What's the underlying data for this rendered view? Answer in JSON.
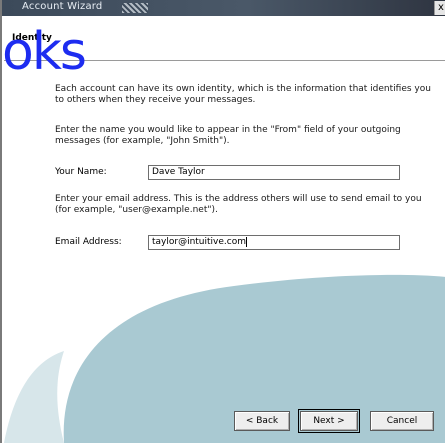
{
  "window": {
    "title": "Account Wizard",
    "close_glyph": "x"
  },
  "header": {
    "heading": "Identity"
  },
  "content": {
    "intro": "Each account can have its own identity, which is the information that identifies you to others when they receive your messages.",
    "name_instructions": "Enter the name you would like to appear in the \"From\" field of your outgoing messages (for example, \"John Smith\").",
    "name_label": "Your Name:",
    "name_value": "Dave Taylor",
    "email_instructions": "Enter your email address. This is the address others will use to send email to you (for example, \"user@example.net\").",
    "email_label": "Email Address:",
    "email_value": "taylor@intuitive.com"
  },
  "buttons": {
    "back": "< Back",
    "next": "Next >",
    "cancel": "Cancel"
  },
  "watermark": {
    "text": "oks"
  },
  "colors": {
    "watermark": "#1d2cf0",
    "swoosh": "#a9c9d2",
    "titlebar": "#3c4a5a"
  }
}
